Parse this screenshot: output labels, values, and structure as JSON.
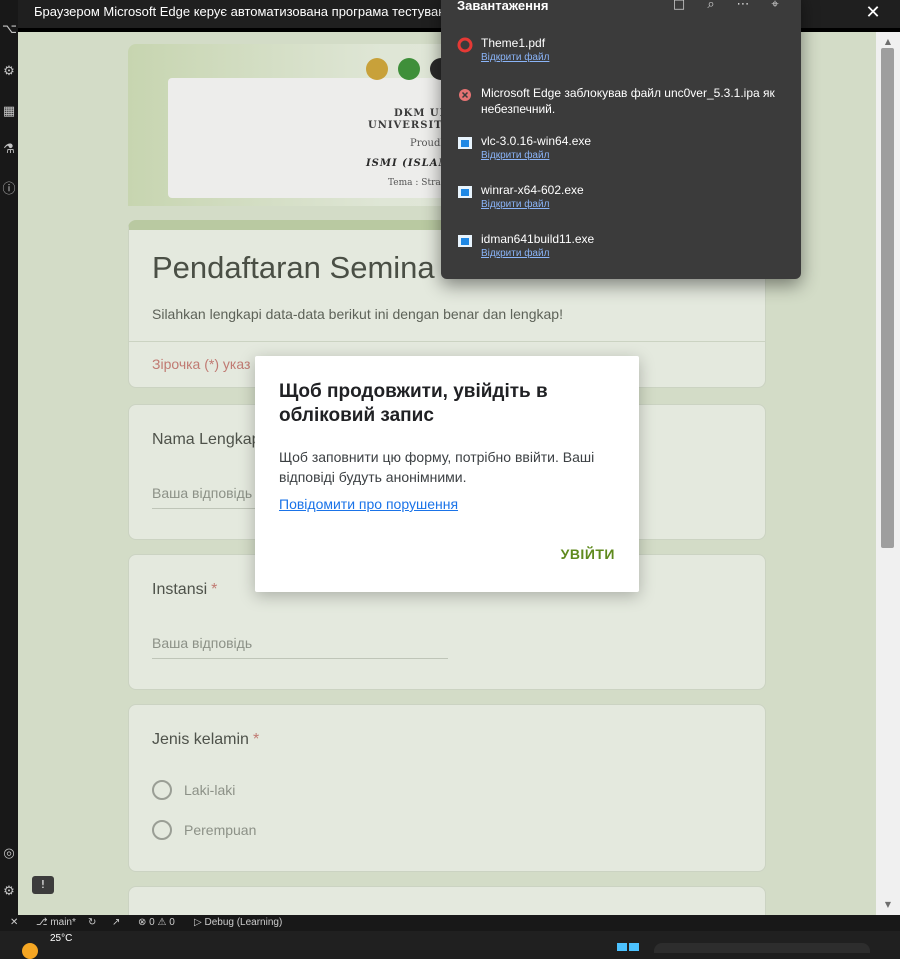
{
  "window": {
    "title": "Браузером Microsoft Edge керує автоматизована програма тестування."
  },
  "banner": {
    "line1": "DKM UL",
    "line2": "UNIVERSITA",
    "line3": "Proudly",
    "line4": "ISMI (ISLAMIC SPECIAL I",
    "line5": "Tema :  Strategi Dakwah dalam"
  },
  "form": {
    "title": "Pendaftaran Semina",
    "description": "Silahkan lengkapi data-data berikut ini dengan benar dan lengkap!",
    "required_note": "Зірочка (*) указ",
    "questions": {
      "nama": {
        "label": "Nama Lengkap",
        "required": "*",
        "placeholder": "Ваша відповідь"
      },
      "instansi": {
        "label": "Instansi",
        "required": "*",
        "placeholder": "Ваша відповідь"
      },
      "jenis": {
        "label": "Jenis kelamin",
        "required": "*",
        "options": [
          "Laki-laki",
          "Perempuan"
        ]
      }
    }
  },
  "dialog": {
    "title": "Щоб продовжити, увійдіть в обліковий запис",
    "body": "Щоб заповнити цю форму, потрібно ввійти. Ваші відповіді будуть анонімними.",
    "report_link": "Повідомити про порушення",
    "signin_label": "УВІЙТИ"
  },
  "downloads": {
    "title": "Завантаження",
    "open_label": "Відкрити файл",
    "items": [
      {
        "name": "Theme1.pdf",
        "icon": "pdf-icon",
        "color": "#e53935"
      },
      {
        "name": "Microsoft Edge заблокував файл unc0ver_5.3.1.ipa як небезпечний.",
        "icon": "blocked-icon",
        "color": "#e57373"
      },
      {
        "name": "vlc-3.0.16-win64.exe",
        "icon": "exe-icon",
        "color": "#4fc3f7"
      },
      {
        "name": "winrar-x64-602.exe",
        "icon": "exe-icon",
        "color": "#4fc3f7"
      },
      {
        "name": "idman641build11.exe",
        "icon": "exe-icon",
        "color": "#4fc3f7"
      }
    ]
  },
  "statusbar": {
    "branch": "main*",
    "problems": "0",
    "warnings": "0",
    "debug": "Debug (Learning)"
  },
  "taskbar": {
    "temperature": "25°C"
  }
}
